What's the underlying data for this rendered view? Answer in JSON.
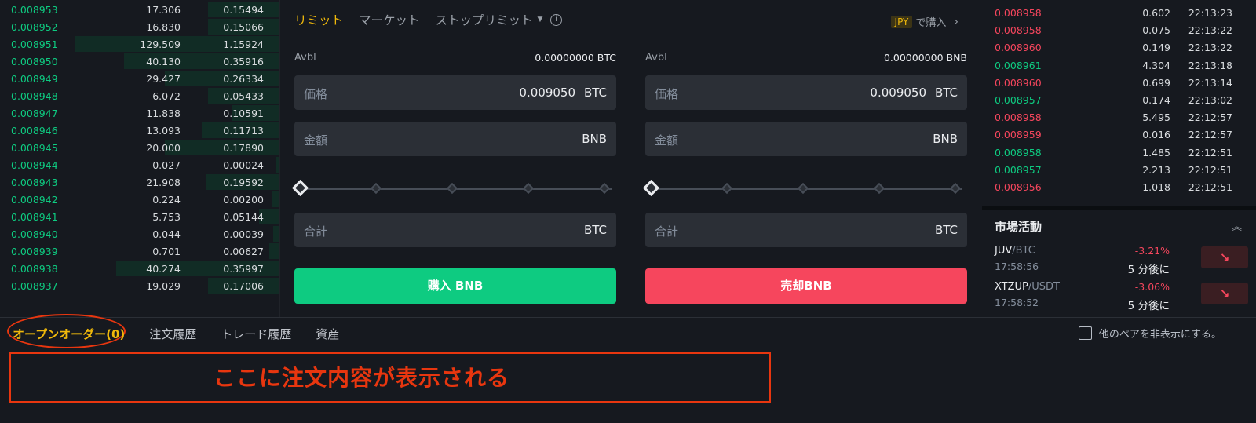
{
  "orderbook": {
    "rows": [
      {
        "price": "0.008953",
        "amount": "17.306",
        "total": "0.15494",
        "depth": 0.35
      },
      {
        "price": "0.008952",
        "amount": "16.830",
        "total": "0.15066",
        "depth": 0.35
      },
      {
        "price": "0.008951",
        "amount": "129.509",
        "total": "1.15924",
        "depth": 1.0
      },
      {
        "price": "0.008950",
        "amount": "40.130",
        "total": "0.35916",
        "depth": 0.76
      },
      {
        "price": "0.008949",
        "amount": "29.427",
        "total": "0.26334",
        "depth": 0.56
      },
      {
        "price": "0.008948",
        "amount": "6.072",
        "total": "0.05433",
        "depth": 0.35
      },
      {
        "price": "0.008947",
        "amount": "11.838",
        "total": "0.10591",
        "depth": 0.23
      },
      {
        "price": "0.008946",
        "amount": "13.093",
        "total": "0.11713",
        "depth": 0.38
      },
      {
        "price": "0.008945",
        "amount": "20.000",
        "total": "0.17890",
        "depth": 0.56
      },
      {
        "price": "0.008944",
        "amount": "0.027",
        "total": "0.00024",
        "depth": 0.02
      },
      {
        "price": "0.008943",
        "amount": "21.908",
        "total": "0.19592",
        "depth": 0.36
      },
      {
        "price": "0.008942",
        "amount": "0.224",
        "total": "0.00200",
        "depth": 0.04
      },
      {
        "price": "0.008941",
        "amount": "5.753",
        "total": "0.05144",
        "depth": 0.1
      },
      {
        "price": "0.008940",
        "amount": "0.044",
        "total": "0.00039",
        "depth": 0.03
      },
      {
        "price": "0.008939",
        "amount": "0.701",
        "total": "0.00627",
        "depth": 0.05
      },
      {
        "price": "0.008938",
        "amount": "40.274",
        "total": "0.35997",
        "depth": 0.8
      },
      {
        "price": "0.008937",
        "amount": "19.029",
        "total": "0.17006",
        "depth": 0.35
      }
    ]
  },
  "tradeform": {
    "tabs": [
      "リミット",
      "マーケット",
      "ストップリミット"
    ],
    "info_icon": "ⓘ",
    "buy_with": {
      "badge": "JPY",
      "label": "で購入",
      "chevron": "›"
    },
    "buy": {
      "avbl_label": "Avbl",
      "avbl_value": "0.00000000 BTC",
      "price_label": "価格",
      "price_value": "0.009050",
      "price_unit": "BTC",
      "amount_label": "金額",
      "amount_unit": "BNB",
      "total_label": "合計",
      "total_unit": "BTC",
      "button": "購入 BNB"
    },
    "sell": {
      "avbl_label": "Avbl",
      "avbl_value": "0.00000000 BNB",
      "price_label": "価格",
      "price_value": "0.009050",
      "price_unit": "BTC",
      "amount_label": "金額",
      "amount_unit": "BNB",
      "total_label": "合計",
      "total_unit": "BTC",
      "button": "売却BNB"
    },
    "slider_value": 0
  },
  "trades": [
    {
      "price": "0.008958",
      "amount": "0.602",
      "time": "22:13:23",
      "dir": "down"
    },
    {
      "price": "0.008958",
      "amount": "0.075",
      "time": "22:13:22",
      "dir": "down"
    },
    {
      "price": "0.008960",
      "amount": "0.149",
      "time": "22:13:22",
      "dir": "down"
    },
    {
      "price": "0.008961",
      "amount": "4.304",
      "time": "22:13:18",
      "dir": "up"
    },
    {
      "price": "0.008960",
      "amount": "0.699",
      "time": "22:13:14",
      "dir": "down"
    },
    {
      "price": "0.008957",
      "amount": "0.174",
      "time": "22:13:02",
      "dir": "up"
    },
    {
      "price": "0.008958",
      "amount": "5.495",
      "time": "22:12:57",
      "dir": "down"
    },
    {
      "price": "0.008959",
      "amount": "0.016",
      "time": "22:12:57",
      "dir": "down"
    },
    {
      "price": "0.008958",
      "amount": "1.485",
      "time": "22:12:51",
      "dir": "up"
    },
    {
      "price": "0.008957",
      "amount": "2.213",
      "time": "22:12:51",
      "dir": "up"
    },
    {
      "price": "0.008956",
      "amount": "1.018",
      "time": "22:12:51",
      "dir": "down"
    }
  ],
  "market_activity": {
    "title": "市場活動",
    "collapse_icon": "︽",
    "items": [
      {
        "base": "JUV",
        "quote": "/BTC",
        "time": "17:58:56",
        "change": "-3.21%",
        "sub": "5 分後に",
        "arrow": "↘"
      },
      {
        "base": "XTZUP",
        "quote": "/USDT",
        "time": "17:58:52",
        "change": "-3.06%",
        "sub": "5 分後に",
        "arrow": "↘"
      }
    ]
  },
  "bottom": {
    "tabs": [
      "オープンオーダー(0)",
      "注文履歴",
      "トレード履歴",
      "資産"
    ],
    "hide_other_pairs": "他のペアを非表示にする。",
    "annotation": "ここに注文内容が表示される"
  },
  "colors": {
    "up": "#0ecb81",
    "down": "#f6465d",
    "accent": "#f0b90b",
    "annotation": "#e8360f"
  }
}
